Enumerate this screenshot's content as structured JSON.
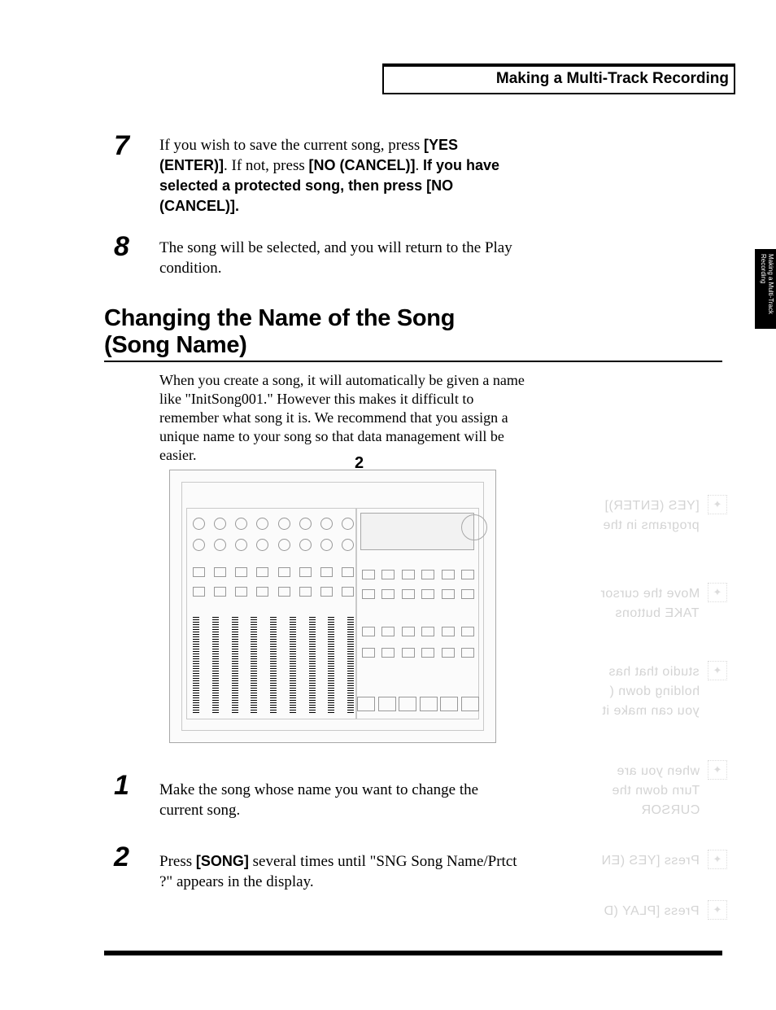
{
  "breadcrumb": "Making a Multi-Track Recording",
  "side_tab": {
    "line1": "Making a Multi-Track",
    "line2": "Recording"
  },
  "steps_top": [
    {
      "num": "7",
      "parts": [
        {
          "t": "If you wish to save the current song, press "
        },
        {
          "t": "[YES (ENTER)]",
          "b": true
        },
        {
          "t": ". If not, press "
        },
        {
          "t": "[NO (CANCEL)]",
          "b": true
        },
        {
          "t": ". "
        },
        {
          "t": "If you have selected a protected song, then press [NO (CANCEL)].",
          "b": true
        }
      ]
    },
    {
      "num": "8",
      "parts": [
        {
          "t": "The song will be selected, and you will return to the Play condition."
        }
      ]
    }
  ],
  "heading": {
    "line1": "Changing the Name of the Song",
    "line2": "(Song Name)"
  },
  "intro": "When you create a song, it will automatically be given a name like \"InitSong001.\" However this makes it difficult to remember what song it is. We recommend that you assign a unique name to your song so that data management will be easier.",
  "figure_callout": "2",
  "steps_bottom": [
    {
      "num": "1",
      "parts": [
        {
          "t": "Make the song whose name you want to change the current song."
        }
      ]
    },
    {
      "num": "2",
      "parts": [
        {
          "t": "Press "
        },
        {
          "t": "[SONG]",
          "b": true
        },
        {
          "t": " several times until \"SNG Song Name/Prtct ?\" appears in the display."
        }
      ]
    }
  ],
  "ghost": {
    "items": [
      "[YES (ENTER)]",
      "programs in the",
      "Move the cursor",
      "TAKE buttons",
      "studio that has",
      "holding down (",
      "you can make it",
      "when you are",
      "Turn down the",
      "CURSOR",
      "Press [YES (EN",
      "Press [PLAY (D"
    ]
  }
}
